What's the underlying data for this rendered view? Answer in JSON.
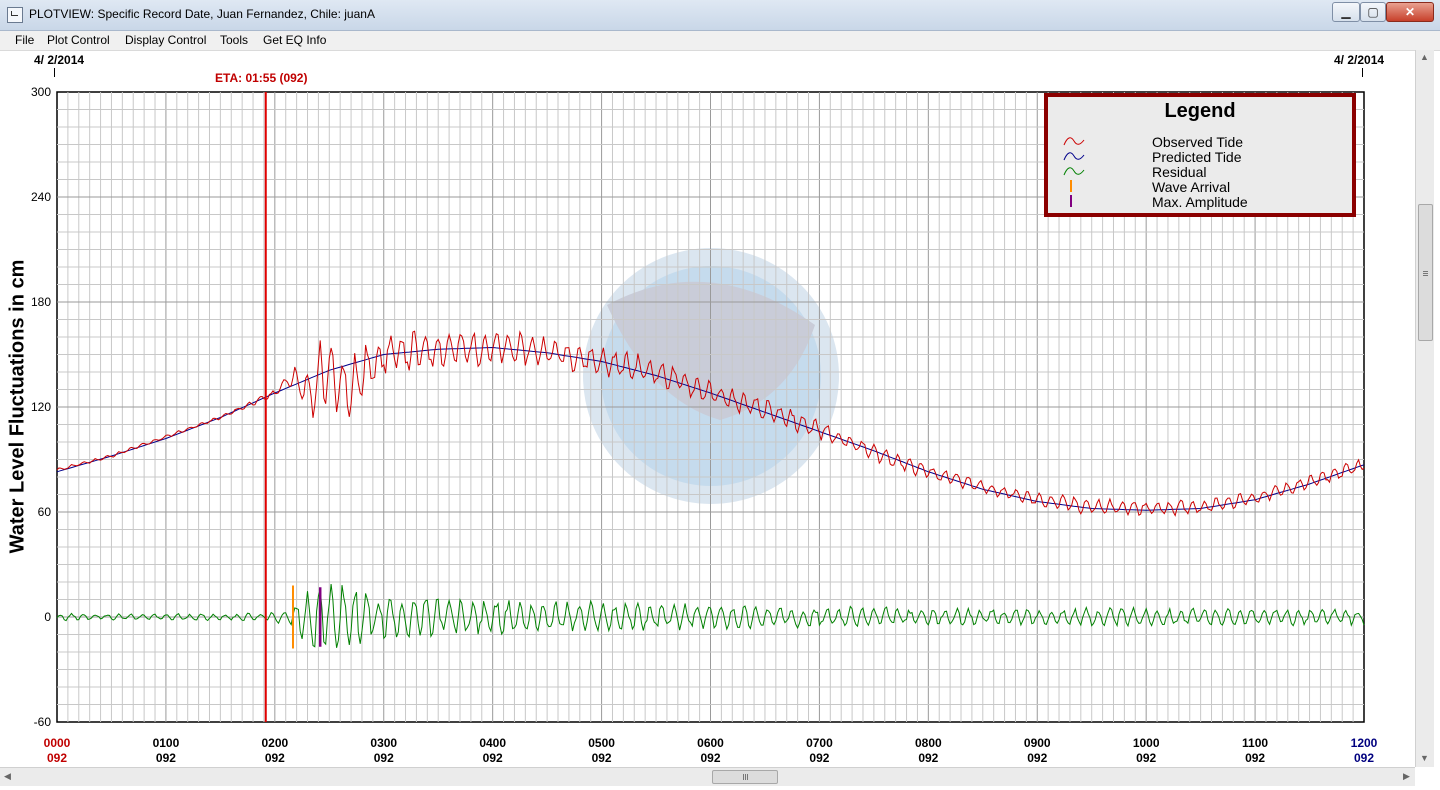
{
  "window": {
    "title": "PLOTVIEW: Specific Record Date, Juan Fernandez, Chile: juanA",
    "minimize": "▁",
    "maximize": "▢",
    "close": "✕"
  },
  "menu": [
    "File",
    "Plot Control",
    "Display Control",
    "Tools",
    "Get EQ Info"
  ],
  "chart_data": {
    "type": "line",
    "ylabel": "Water Level Fluctuations in cm",
    "start_date": "4/ 2/2014",
    "end_date": "4/ 2/2014",
    "eta_label": "ETA: 01:55 (092)",
    "eta_time": "01:55",
    "wave_arrival_time": "02:10",
    "max_amplitude_time": "02:25",
    "ylim": [
      -60,
      300
    ],
    "yticks": [
      "300",
      "240",
      "180",
      "120",
      "60",
      "0",
      "-60"
    ],
    "xticks": [
      {
        "time": "0000",
        "day": "092",
        "color": "#c00000"
      },
      {
        "time": "0100",
        "day": "092",
        "color": "#000000"
      },
      {
        "time": "0200",
        "day": "092",
        "color": "#000000"
      },
      {
        "time": "0300",
        "day": "092",
        "color": "#000000"
      },
      {
        "time": "0400",
        "day": "092",
        "color": "#000000"
      },
      {
        "time": "0500",
        "day": "092",
        "color": "#000000"
      },
      {
        "time": "0600",
        "day": "092",
        "color": "#000000"
      },
      {
        "time": "0700",
        "day": "092",
        "color": "#000000"
      },
      {
        "time": "0800",
        "day": "092",
        "color": "#000000"
      },
      {
        "time": "0900",
        "day": "092",
        "color": "#000000"
      },
      {
        "time": "1000",
        "day": "092",
        "color": "#000000"
      },
      {
        "time": "1100",
        "day": "092",
        "color": "#000000"
      },
      {
        "time": "1200",
        "day": "092",
        "color": "#00007f"
      }
    ],
    "grid": true,
    "legend": {
      "title": "Legend",
      "placement": "top-right",
      "entries": [
        {
          "label": "Observed Tide",
          "color": "#cc0000",
          "symbol": "wave"
        },
        {
          "label": "Predicted Tide",
          "color": "#00008b",
          "symbol": "wave"
        },
        {
          "label": "Residual",
          "color": "#008000",
          "symbol": "wave"
        },
        {
          "label": "Wave Arrival",
          "color": "#ff8c00",
          "symbol": "bar"
        },
        {
          "label": "Max. Amplitude",
          "color": "#800080",
          "symbol": "bar"
        }
      ]
    },
    "series": [
      {
        "name": "Predicted Tide",
        "color": "#00008b",
        "x": [
          "00:00",
          "00:30",
          "01:00",
          "01:30",
          "02:00",
          "02:30",
          "03:00",
          "03:30",
          "04:00",
          "04:30",
          "05:00",
          "05:30",
          "06:00",
          "06:30",
          "07:00",
          "07:30",
          "08:00",
          "08:30",
          "09:00",
          "09:30",
          "10:00",
          "10:30",
          "11:00",
          "11:30",
          "12:00"
        ],
        "y": [
          83,
          92,
          102,
          114,
          128,
          141,
          150,
          153,
          154,
          151,
          146,
          138,
          128,
          117,
          106,
          95,
          83,
          73,
          66,
          62,
          61,
          62,
          67,
          76,
          87
        ]
      },
      {
        "name": "Observed Tide",
        "color": "#cc0000",
        "x": [
          "00:00",
          "00:30",
          "01:00",
          "01:30",
          "02:00",
          "02:10",
          "02:20",
          "02:25",
          "02:40",
          "03:00",
          "03:30",
          "04:00",
          "04:30",
          "05:00",
          "05:30",
          "06:00",
          "06:30",
          "07:00",
          "07:30",
          "08:00",
          "08:30",
          "09:00",
          "09:30",
          "10:00",
          "10:30",
          "11:00",
          "11:30",
          "12:00"
        ],
        "y": [
          84,
          92,
          103,
          114,
          128,
          138,
          125,
          140,
          131,
          150,
          153,
          154,
          152,
          146,
          140,
          128,
          118,
          107,
          94,
          83,
          74,
          67,
          63,
          62,
          63,
          68,
          77,
          87
        ],
        "oscillation_cm": [
          1,
          1,
          1,
          1,
          2,
          6,
          18,
          20,
          20,
          14,
          12,
          10,
          9,
          9,
          8,
          7,
          7,
          6,
          5,
          5,
          4,
          4,
          5,
          5,
          4,
          4,
          4,
          4
        ]
      },
      {
        "name": "Residual",
        "color": "#008000",
        "x": [
          "00:00",
          "00:30",
          "01:00",
          "01:30",
          "02:00",
          "02:10",
          "02:20",
          "02:25",
          "02:40",
          "03:00",
          "03:30",
          "04:00",
          "04:30",
          "05:00",
          "05:30",
          "06:00",
          "06:30",
          "07:00",
          "07:30",
          "08:00",
          "08:30",
          "09:00",
          "09:30",
          "10:00",
          "10:30",
          "11:00",
          "11:30",
          "12:00"
        ],
        "y": [
          0,
          0,
          0,
          0,
          0,
          0,
          0,
          0,
          0,
          0,
          0,
          0,
          0,
          0,
          0,
          0,
          0,
          0,
          0,
          0,
          0,
          0,
          0,
          0,
          0,
          0,
          0,
          0
        ],
        "oscillation_cm": [
          2,
          2,
          2,
          2,
          3,
          6,
          18,
          20,
          20,
          14,
          12,
          10,
          9,
          9,
          8,
          7,
          7,
          6,
          6,
          5,
          5,
          5,
          6,
          5,
          5,
          5,
          5,
          5
        ]
      }
    ]
  }
}
